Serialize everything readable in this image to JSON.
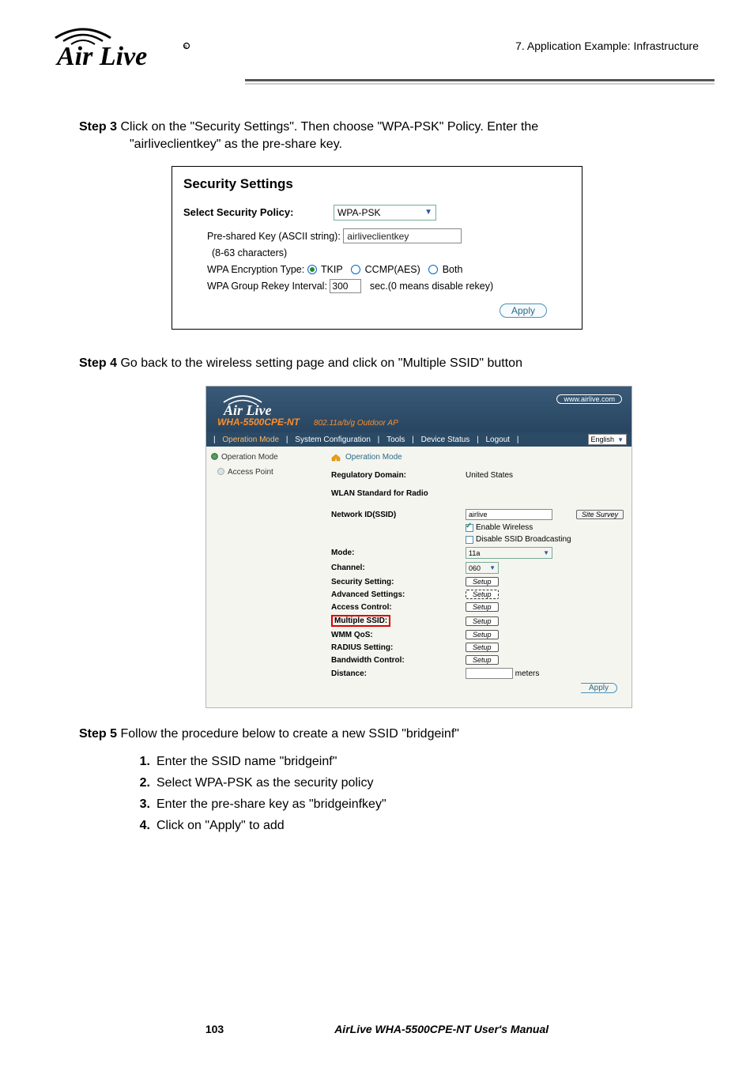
{
  "header": {
    "chapter_title": "7.  Application  Example:  Infrastructure",
    "logo_brand": "Air",
    "logo_brand2": "Live"
  },
  "step3": {
    "label": "Step 3",
    "text_line1": "  Click on the \"Security Settings\".    Then choose \"WPA-PSK\" Policy.    Enter the",
    "text_line2": "\"airliveclientkey\" as the pre-share key."
  },
  "security_panel": {
    "title": "Security Settings",
    "select_policy_label": "Select Security Policy:",
    "policy_value": "WPA-PSK",
    "psk_label": "Pre-shared Key (ASCII string):",
    "psk_hint": "(8-63 characters)",
    "psk_value": "airliveclientkey",
    "enc_label": "WPA Encryption Type:",
    "enc_tkip": "TKIP",
    "enc_ccmp": "CCMP(AES)",
    "enc_both": "Both",
    "rekey_label": "WPA Group Rekey Interval:",
    "rekey_value": "300",
    "rekey_suffix": "sec.(0 means disable rekey)",
    "apply": "Apply"
  },
  "step4": {
    "label": "Step 4",
    "text": "  Go back to the wireless setting page and click on \"Multiple SSID\" button"
  },
  "router": {
    "website": "www.airlive.com",
    "model": "WHA-5500CPE-NT",
    "subtitle": "802.11a/b/g Outdoor AP",
    "nav": {
      "op_mode": "Operation Mode",
      "sys_conf": "System Configuration",
      "tools": "Tools",
      "dev_status": "Device Status",
      "logout": "Logout",
      "language": "English"
    },
    "sidebar": {
      "head": "Operation Mode",
      "item1": "Access Point"
    },
    "main": {
      "crumb": "Operation Mode",
      "reg_domain_label": "Regulatory Domain:",
      "reg_domain_value": "United States",
      "wlan_std_label": "WLAN Standard for Radio",
      "ssid_label": "Network ID(SSID)",
      "ssid_value": "airlive",
      "site_survey": "Site Survey",
      "enable_wireless": "Enable Wireless",
      "disable_broadcast": "Disable SSID Broadcasting",
      "mode_label": "Mode:",
      "mode_value": "11a",
      "channel_label": "Channel:",
      "channel_value": "060",
      "security_label": "Security Setting:",
      "advanced_label": "Advanced Settings:",
      "access_label": "Access Control:",
      "mssid_label": "Multiple SSID:",
      "wmm_label": "WMM QoS:",
      "radius_label": "RADIUS Setting:",
      "bw_label": "Bandwidth Control:",
      "distance_label": "Distance:",
      "distance_unit": "meters",
      "setup": "Setup",
      "apply": "Apply"
    }
  },
  "step5": {
    "label": "Step 5",
    "text": "  Follow the procedure below to create a new SSID \"bridgeinf\"",
    "items": [
      "Enter the SSID name \"bridgeinf\"",
      "Select WPA-PSK as the security policy",
      "Enter the pre-share key as \"bridgeinfkey\"",
      "Click on \"Apply\" to add"
    ]
  },
  "footer": {
    "page": "103",
    "doc": "AirLive  WHA-5500CPE-NT  User's  Manual"
  }
}
